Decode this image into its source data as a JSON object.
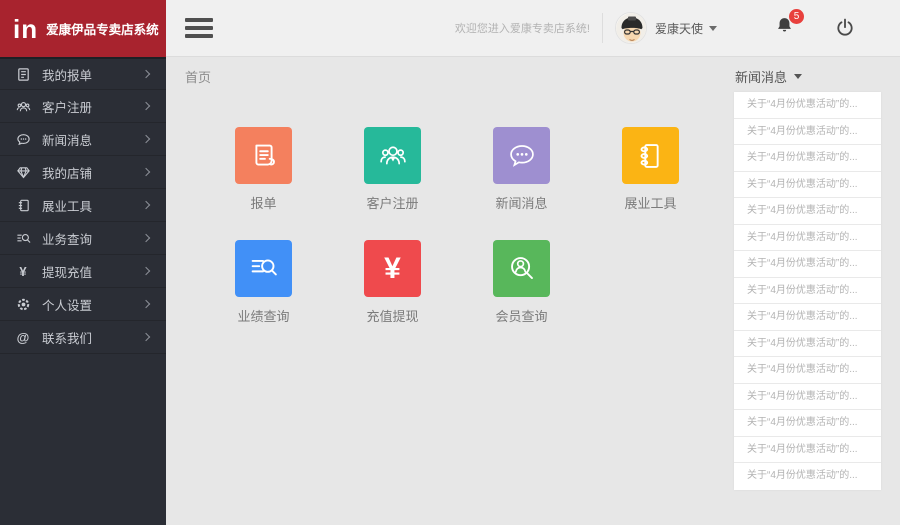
{
  "app": {
    "logo_mark": "in",
    "title": "爱康伊品专卖店系统"
  },
  "topbar": {
    "welcome": "欢迎您进入爱康专卖店系统!",
    "username": "爱康天使",
    "notification_count": "5",
    "icons": [
      "hamburger-icon",
      "avatar",
      "caret-down-icon",
      "bell-icon",
      "power-icon"
    ]
  },
  "breadcrumb": "首页",
  "sidebar": {
    "items": [
      {
        "label": "我的报单",
        "icon": "report-doc-icon"
      },
      {
        "label": "客户注册",
        "icon": "customer-register-icon"
      },
      {
        "label": "新闻消息",
        "icon": "news-message-icon"
      },
      {
        "label": "我的店铺",
        "icon": "my-shop-icon"
      },
      {
        "label": "展业工具",
        "icon": "business-tools-icon"
      },
      {
        "label": "业务查询",
        "icon": "business-query-icon"
      },
      {
        "label": "提现充值",
        "icon": "withdraw-recharge-icon"
      },
      {
        "label": "个人设置",
        "icon": "personal-settings-icon"
      },
      {
        "label": "联系我们",
        "icon": "contact-us-icon"
      }
    ]
  },
  "tiles": [
    {
      "label": "报单",
      "icon": "report-doc-icon",
      "color": "#f4805e"
    },
    {
      "label": "客户注册",
      "icon": "customer-register-icon",
      "color": "#26b99a"
    },
    {
      "label": "新闻消息",
      "icon": "news-message-icon",
      "color": "#9e8fd0"
    },
    {
      "label": "展业工具",
      "icon": "business-tools-icon",
      "color": "#fbb414"
    },
    {
      "label": "业绩查询",
      "icon": "performance-query-icon",
      "color": "#4190f7"
    },
    {
      "label": "充值提现",
      "icon": "recharge-withdraw-icon",
      "color": "#ef4a4d"
    },
    {
      "label": "会员查询",
      "icon": "member-query-icon",
      "color": "#58b75b"
    }
  ],
  "glyphs": {
    "yen": "¥",
    "at": "@"
  },
  "news_panel": {
    "title": "新闻消息",
    "items": [
      "关于“4月份优惠活动”的...",
      "关于“4月份优惠活动”的...",
      "关于“4月份优惠活动”的...",
      "关于“4月份优惠活动”的...",
      "关于“4月份优惠活动”的...",
      "关于“4月份优惠活动”的...",
      "关于“4月份优惠活动”的...",
      "关于“4月份优惠活动”的...",
      "关于“4月份优惠活动”的...",
      "关于“4月份优惠活动”的...",
      "关于“4月份优惠活动”的...",
      "关于“4月份优惠活动”的...",
      "关于“4月份优惠活动”的...",
      "关于“4月份优惠活动”的...",
      "关于“4月份优惠活动”的..."
    ]
  },
  "colors": {
    "brand_red": "#a8232e",
    "sidebar_bg": "#2b2e36",
    "topbar_bg": "#f0f0f0",
    "content_bg": "#e7e7e7",
    "badge_red": "#e8403d"
  }
}
